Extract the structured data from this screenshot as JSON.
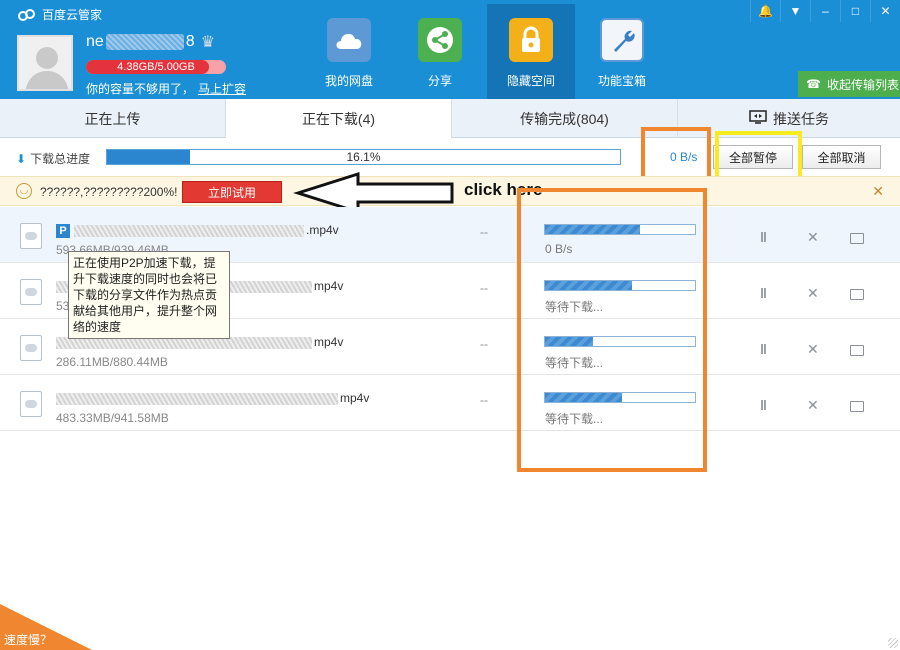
{
  "app": {
    "title": "百度云管家"
  },
  "window_controls": [
    "bell-icon",
    "menu-icon",
    "minimize-icon",
    "maximize-icon",
    "close-icon"
  ],
  "user": {
    "name_prefix": "ne",
    "name_suffix": "8",
    "quota_text": "4.38GB/5.00GB",
    "quota_fraction": 0.876,
    "quota_note": "你的容量不够用了，",
    "quota_link": "马上扩容"
  },
  "nav": [
    {
      "label": "我的网盘",
      "icon": "cloud-icon",
      "color": "#5d99d4"
    },
    {
      "label": "分享",
      "icon": "share-icon",
      "color": "#4caf50"
    },
    {
      "label": "隐藏空间",
      "icon": "lock-icon",
      "color": "#f3b019"
    },
    {
      "label": "功能宝箱",
      "icon": "wrench-icon",
      "color": "#5d99d4"
    }
  ],
  "collapse_label": "收起传输列表",
  "tabs": [
    {
      "label": "正在上传"
    },
    {
      "label": "正在下载(4)"
    },
    {
      "label": "传输完成(804)"
    },
    {
      "label": "推送任务"
    }
  ],
  "progress": {
    "label": "下载总进度",
    "percent_text": "16.1%",
    "fraction": 0.161,
    "speed": "0 B/s",
    "pause_all": "全部暂停",
    "cancel_all": "全部取消"
  },
  "notice": {
    "text": "??????,?????????200%!",
    "button": "立即试用",
    "annotation": "click here"
  },
  "downloads": [
    {
      "name_suffix": ".mp4v",
      "size": "593.66MB/939.46MB",
      "eta": "--",
      "progress": 0.63,
      "status": "0 B/s"
    },
    {
      "name_suffix": "mp4v",
      "size": "53",
      "eta": "--",
      "progress": 0.58,
      "status": "等待下载..."
    },
    {
      "name_suffix": "mp4v",
      "size": "286.11MB/880.44MB",
      "eta": "--",
      "progress": 0.32,
      "status": "等待下载..."
    },
    {
      "name_suffix": "mp4v",
      "size": "483.33MB/941.58MB",
      "eta": "--",
      "progress": 0.51,
      "status": "等待下载..."
    }
  ],
  "tooltip": "正在使用P2P加速下载，提升下载速度的同时也会将已下载的分享文件作为热点贡献给其他用户，提升整个网络的速度",
  "slow_label": "速度慢？"
}
